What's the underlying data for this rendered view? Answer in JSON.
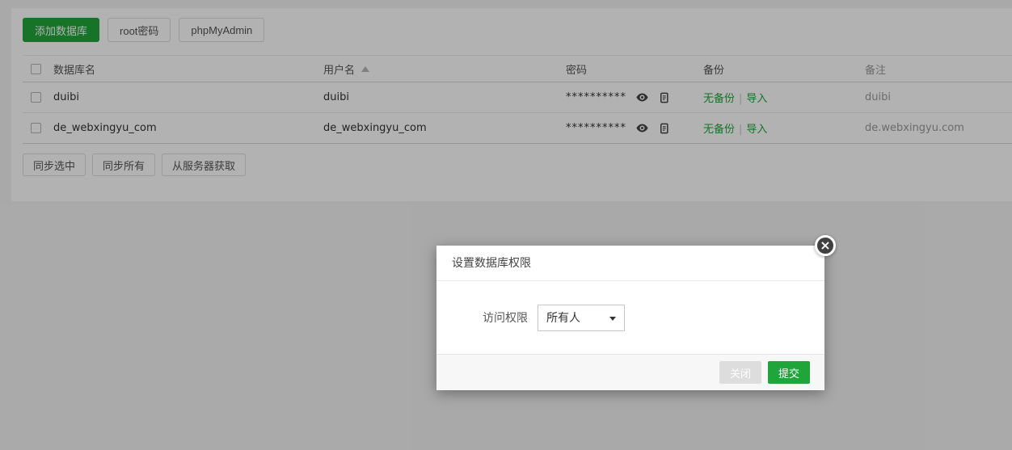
{
  "toolbar": {
    "add_db": "添加数据库",
    "root_pwd": "root密码",
    "phpmyadmin": "phpMyAdmin"
  },
  "table": {
    "headers": {
      "name": "数据库名",
      "user": "用户名",
      "password": "密码",
      "backup": "备份",
      "note": "备注"
    },
    "sep": "|",
    "rows": [
      {
        "name": "duibi",
        "user": "duibi",
        "password": "**********",
        "no_backup": "无备份",
        "import": "导入",
        "note": "duibi"
      },
      {
        "name": "de_webxingyu_com",
        "user": "de_webxingyu_com",
        "password": "**********",
        "no_backup": "无备份",
        "import": "导入",
        "note": "de.webxingyu.com"
      }
    ]
  },
  "actions": {
    "sync_selected": "同步选中",
    "sync_all": "同步所有",
    "fetch_from_server": "从服务器获取"
  },
  "modal": {
    "title": "设置数据库权限",
    "close_x": "×",
    "field_label": "访问权限",
    "select_value": "所有人",
    "close_label": "关闭",
    "submit_label": "提交"
  },
  "colors": {
    "primary_green": "#20a53a",
    "note_text": "#9a9a9a",
    "overlay": "rgba(0,0,0,0.30)"
  }
}
